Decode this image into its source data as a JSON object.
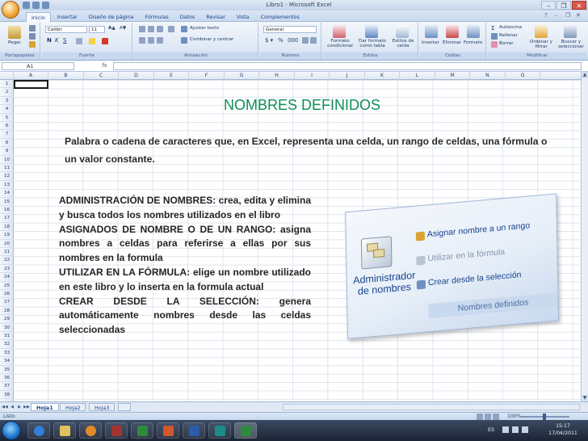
{
  "window": {
    "title": "Libro1 - Microsoft Excel"
  },
  "tabs": [
    "Inicio",
    "Insertar",
    "Diseño de página",
    "Fórmulas",
    "Datos",
    "Revisar",
    "Vista",
    "Complementos"
  ],
  "ribbon": {
    "paste_label": "Pegar",
    "font_name": "Calibri",
    "font_size": "11",
    "wrap_text": "Ajustar texto",
    "merge_center": "Combinar y centrar",
    "number_format": "General",
    "conditional_format": "Formato condicional",
    "format_as_table": "Dar formato como tabla",
    "cell_styles": "Estilos de celda",
    "insert": "Insertar",
    "delete": "Eliminar",
    "format": "Formato",
    "autosum": "Autosuma",
    "fill": "Rellenar",
    "clear": "Borrar",
    "sort_filter": "Ordenar y filtrar",
    "find_select": "Buscar y seleccionar",
    "group_labels": [
      "Portapapeles",
      "Fuente",
      "Alineación",
      "Número",
      "Estilos",
      "Celdas",
      "Modificar"
    ]
  },
  "formula_bar": {
    "name_box": "A1",
    "fx": "fx"
  },
  "columns": [
    "A",
    "B",
    "C",
    "D",
    "E",
    "F",
    "G",
    "H",
    "I",
    "J",
    "K",
    "L",
    "M",
    "N",
    "O"
  ],
  "rows": [
    "1",
    "2",
    "3",
    "4",
    "5",
    "6",
    "7",
    "8",
    "9",
    "10",
    "11",
    "12",
    "13",
    "14",
    "15",
    "16",
    "17",
    "18",
    "19",
    "20",
    "21",
    "22",
    "23",
    "24",
    "25",
    "26",
    "27",
    "28",
    "29",
    "30",
    "31",
    "32",
    "33",
    "34",
    "35",
    "36",
    "37",
    "38"
  ],
  "content": {
    "heading": "NOMBRES DEFINIDOS",
    "definition": "Palabra o cadena de caracteres que, en Excel, representa una celda, un rango de celdas, una fórmula o un valor constante.",
    "items": [
      "ADMINISTRACIÓN DE NOMBRES: crea, edita y elimina y busca todos los nombres utilizados en el libro",
      "ASIGNADOS DE NOMBRE O DE UN RANGO: asigna nombres a celdas para referirse a ellas por sus nombres en la formula",
      "UTILIZAR EN LA FÓRMULA: elige un nombre utilizado en este libro y lo inserta en la formula actual",
      "CREAR DESDE LA SELECCIÓN: genera automáticamente nombres desde las celdas seleccionadas"
    ]
  },
  "image": {
    "admin_label": "Administrador de nombres",
    "assign": "Asignar nombre a un rango",
    "use_in_formula": "Utilizar en la fórmula",
    "create_from_selection": "Crear desde la selección",
    "group_label": "Nombres definidos"
  },
  "sheets": [
    "Hoja1",
    "Hoja2",
    "Hoja3"
  ],
  "status": {
    "text": "Listo",
    "zoom": "100%"
  },
  "taskbar": {
    "language": "ES",
    "time": "15:17",
    "date": "17/04/2011"
  },
  "colors": {
    "heading": "#0e8f57",
    "ribbon_text": "#15428b"
  }
}
